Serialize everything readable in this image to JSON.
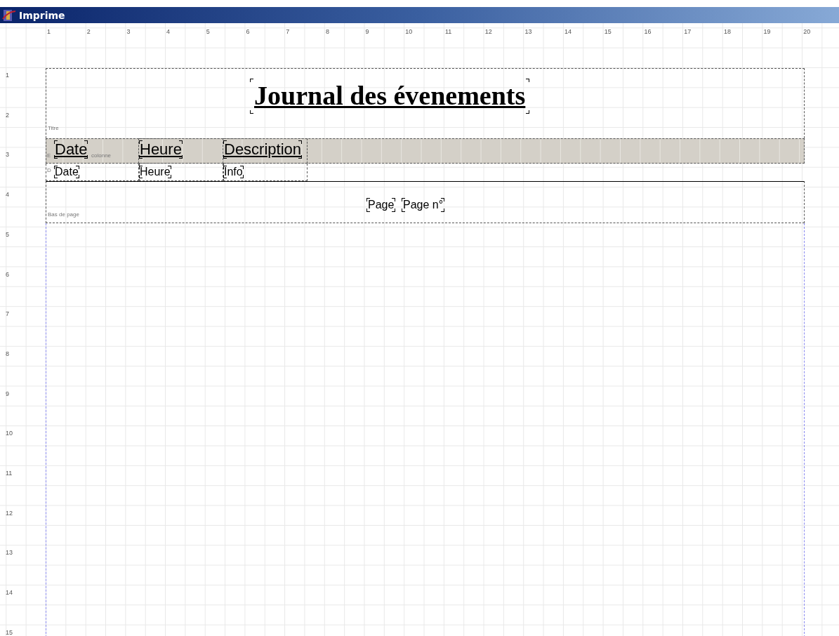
{
  "window": {
    "title": "Imprime"
  },
  "ruler": {
    "columns": [
      "1",
      "2",
      "3",
      "4",
      "5",
      "6",
      "7",
      "8",
      "9",
      "10",
      "11",
      "12",
      "13",
      "14",
      "15",
      "16",
      "17",
      "18",
      "19",
      "20"
    ],
    "rows": [
      "1",
      "2",
      "3",
      "4",
      "5",
      "6",
      "7",
      "8",
      "9",
      "10",
      "11",
      "12",
      "13",
      "14",
      "15"
    ]
  },
  "report": {
    "title_band": {
      "label": "Titre",
      "title": "Journal des évenements"
    },
    "column_header": {
      "label_parts": [
        "E",
        "colonne"
      ],
      "fields": [
        "Date",
        "Heure",
        "Description"
      ]
    },
    "detail": {
      "label": "D",
      "fields": [
        "Date",
        "Heure",
        "Info"
      ]
    },
    "footer": {
      "label": "Bas de page",
      "fields": [
        "Page",
        "Page n°"
      ]
    }
  }
}
